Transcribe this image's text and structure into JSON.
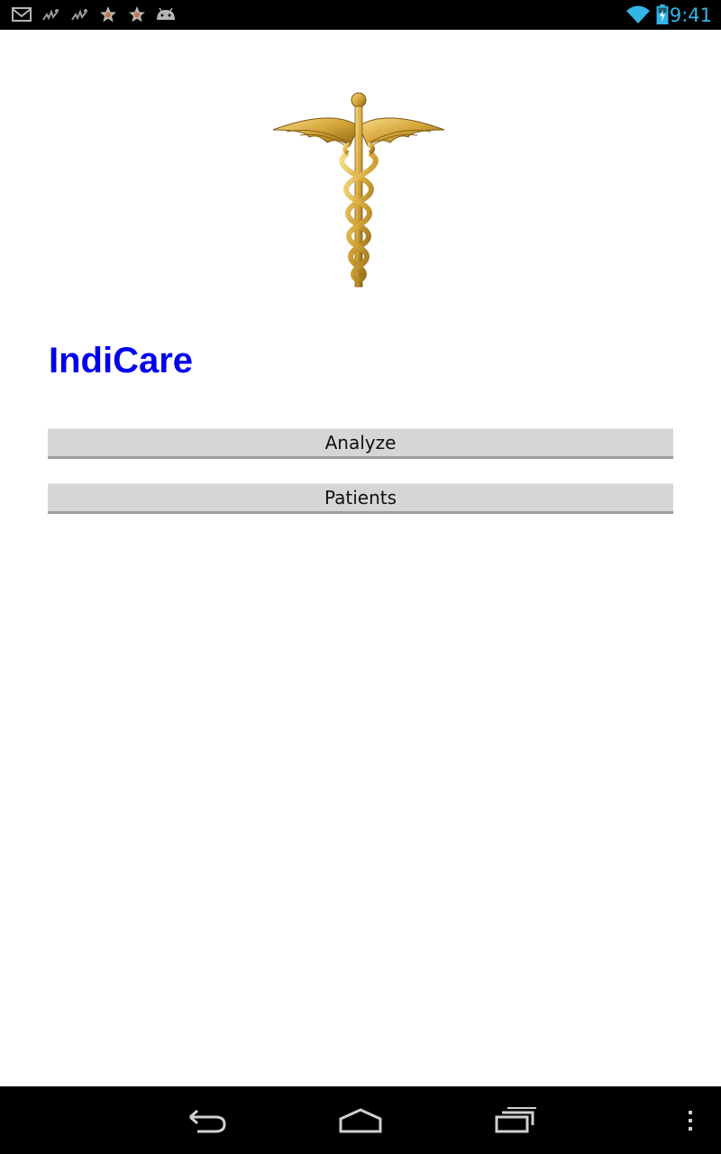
{
  "status_bar": {
    "time": "9:41",
    "time_color": "#33b5e5",
    "notification_icons": [
      "gmail-icon",
      "signal-app-icon",
      "signal-app-icon",
      "star-icon",
      "star-icon",
      "android-icon"
    ],
    "system_icons": [
      "wifi-icon",
      "battery-charging-icon"
    ]
  },
  "app": {
    "logo_icon": "caduceus-icon",
    "title": "IndiCare",
    "title_color": "#0000ee"
  },
  "buttons": {
    "analyze_label": "Analyze",
    "patients_label": "Patients"
  },
  "nav_bar": {
    "buttons": [
      "back-icon",
      "home-icon",
      "recent-apps-icon",
      "overflow-menu-icon"
    ]
  }
}
